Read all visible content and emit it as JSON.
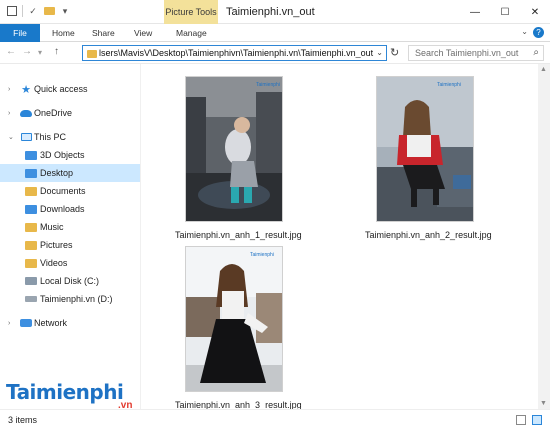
{
  "window": {
    "context_tab": "Picture Tools",
    "title": "Taimienphi.vn_out",
    "controls": [
      "—",
      "☐",
      "✕"
    ]
  },
  "ribbon": {
    "tabs": [
      "File",
      "Home",
      "Share",
      "View",
      "Manage"
    ]
  },
  "address_bar": {
    "path": "lsers\\MavisV\\Desktop\\Taimienphivn\\Taimienphi.vn\\Taimienphi.vn_out",
    "search_placeholder": "Search Taimienphi.vn_out"
  },
  "nav_pane": {
    "items": [
      {
        "label": "Quick access",
        "icon": "star-icon"
      },
      {
        "label": "OneDrive",
        "icon": "cloud-icon"
      },
      {
        "label": "This PC",
        "icon": "computer-icon"
      },
      {
        "label": "3D Objects",
        "icon": "folder-3d-icon"
      },
      {
        "label": "Desktop",
        "icon": "folder-desktop-icon",
        "selected": true
      },
      {
        "label": "Documents",
        "icon": "folder-documents-icon"
      },
      {
        "label": "Downloads",
        "icon": "folder-downloads-icon"
      },
      {
        "label": "Music",
        "icon": "folder-music-icon"
      },
      {
        "label": "Pictures",
        "icon": "folder-pictures-icon"
      },
      {
        "label": "Videos",
        "icon": "folder-videos-icon"
      },
      {
        "label": "Local Disk (C:)",
        "icon": "disk-icon"
      },
      {
        "label": "Taimienphi.vn (D:)",
        "icon": "drive-icon"
      },
      {
        "label": "Network",
        "icon": "network-icon"
      }
    ]
  },
  "files": [
    {
      "name": "Taimienphi.vn_anh_1_result.jpg"
    },
    {
      "name": "Taimienphi.vn_anh_2_result.jpg"
    },
    {
      "name": "Taimienphi.vn_anh_3_result.jpg"
    }
  ],
  "status": {
    "count": "3 items"
  },
  "watermark": {
    "brand": "Taimienphi",
    "tld": ".vn"
  },
  "colors": {
    "accent": "#1979ca",
    "selection": "#cce8ff",
    "context_tab": "#f3e19a",
    "brand_red": "#e23b2f"
  }
}
